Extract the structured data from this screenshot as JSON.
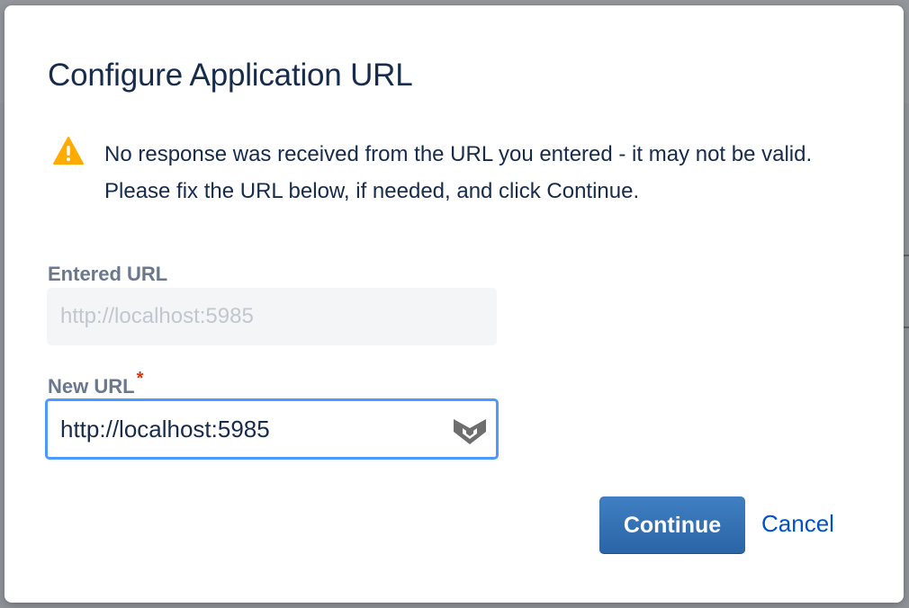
{
  "dialog": {
    "title": "Configure Application URL",
    "warning": {
      "icon": "warning-icon",
      "color": "#ffab00",
      "message": "No response was received from the URL you entered - it may not be valid. Please fix the URL below, if needed, and click Continue."
    },
    "entered_url": {
      "label": "Entered URL",
      "value": "http://localhost:5985"
    },
    "new_url": {
      "label": "New URL",
      "required_marker": "*",
      "value": "http://localhost:5985",
      "extension_icon": "password-manager-icon"
    },
    "actions": {
      "continue_label": "Continue",
      "cancel_label": "Cancel"
    }
  },
  "colors": {
    "title": "#172b4d",
    "label": "#6b778c",
    "focus_border": "#4c9aff",
    "primary_button": "#2a65a6",
    "link": "#0052cc",
    "required": "#de350b"
  }
}
